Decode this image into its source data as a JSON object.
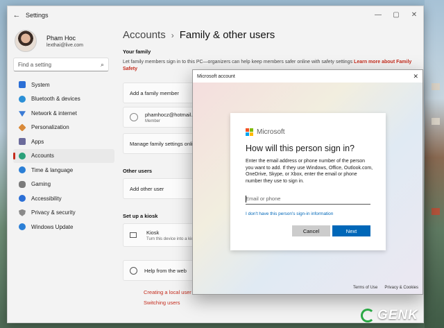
{
  "window": {
    "title": "Settings"
  },
  "profile": {
    "name": "Pham Hoc",
    "email": "lexthai@live.com"
  },
  "search": {
    "placeholder": "Find a setting"
  },
  "sidebar": {
    "items": [
      {
        "label": "System",
        "color": "#2b6fd6"
      },
      {
        "label": "Bluetooth & devices",
        "color": "#2b8fd6"
      },
      {
        "label": "Network & internet",
        "color": "#3a7bd5"
      },
      {
        "label": "Personalization",
        "color": "#d98a3a"
      },
      {
        "label": "Apps",
        "color": "#6b6b9b"
      },
      {
        "label": "Accounts",
        "color": "#2aa07a"
      },
      {
        "label": "Time & language",
        "color": "#2b7fd6"
      },
      {
        "label": "Gaming",
        "color": "#7a7a7a"
      },
      {
        "label": "Accessibility",
        "color": "#2b6fd6"
      },
      {
        "label": "Privacy & security",
        "color": "#8a8a8a"
      },
      {
        "label": "Windows Update",
        "color": "#2b7fd6"
      }
    ]
  },
  "breadcrumb": {
    "parent": "Accounts",
    "separator": "›",
    "current": "Family & other users"
  },
  "main": {
    "your_family_heading": "Your family",
    "family_description": "Let family members sign in to this PC—organizers can help keep members safer online with safety settings",
    "family_link": "Learn more about Family Safety",
    "add_family_member": "Add a family member",
    "member_email": "phamhocz@hotmail.co",
    "member_role": "Member",
    "manage_family": "Manage family settings online",
    "other_users_heading": "Other users",
    "add_other_user": "Add other user",
    "kiosk_heading": "Set up a kiosk",
    "kiosk_title": "Kiosk",
    "kiosk_desc": "Turn this device into a kio",
    "help_title": "Help from the web",
    "help_link_1": "Creating a local user ac",
    "help_link_2": "Switching users"
  },
  "dialog": {
    "title": "Microsoft account",
    "brand": "Microsoft",
    "heading": "How will this person sign in?",
    "body": "Enter the email address or phone number of the person you want to add. If they use Windows, Office, Outlook.com, OneDrive, Skype, or Xbox, enter the email or phone number they use to sign in.",
    "input_placeholder": "Email or phone",
    "no_info_link": "I don't have this person's sign-in information",
    "cancel_label": "Cancel",
    "next_label": "Next",
    "terms": "Terms of Use",
    "privacy": "Privacy & Cookies"
  },
  "watermark": {
    "text": "GENK"
  }
}
